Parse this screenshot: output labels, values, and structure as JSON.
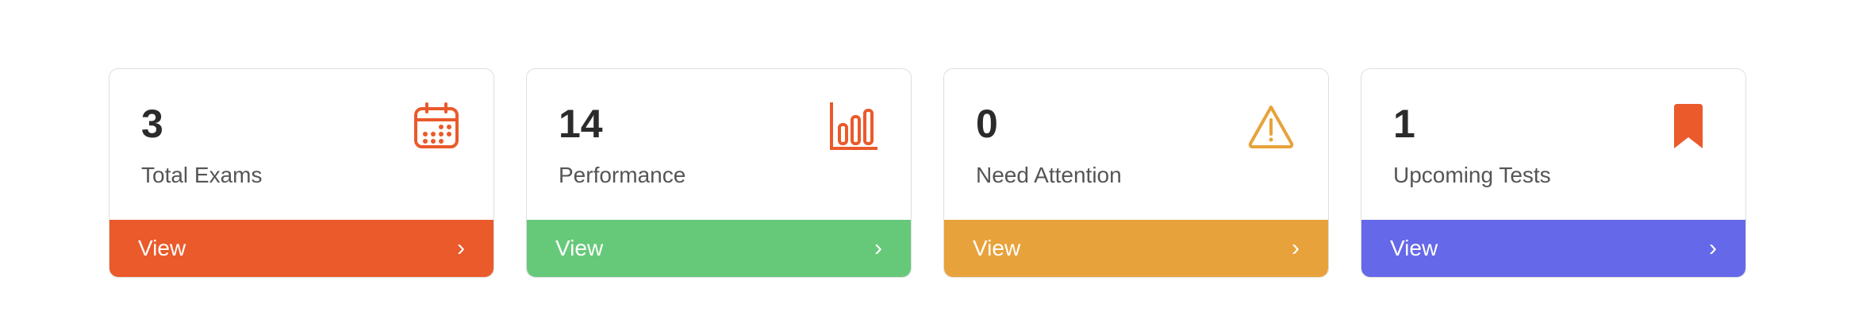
{
  "cards": [
    {
      "value": "3",
      "label": "Total Exams",
      "icon": "calendar-icon",
      "color": "#ea5a2b",
      "footer_label": "View",
      "chevron": "›"
    },
    {
      "value": "14",
      "label": "Performance",
      "icon": "bar-chart-icon",
      "color": "#66c97a",
      "icon_color": "#ea5a2b",
      "footer_label": "View",
      "chevron": "›"
    },
    {
      "value": "0",
      "label": "Need Attention",
      "icon": "warning-icon",
      "color": "#e8a23b",
      "footer_label": "View",
      "chevron": "›"
    },
    {
      "value": "1",
      "label": "Upcoming Tests",
      "icon": "bookmark-icon",
      "color": "#6568e8",
      "icon_color": "#ea5a2b",
      "footer_label": "View",
      "chevron": "›"
    }
  ]
}
